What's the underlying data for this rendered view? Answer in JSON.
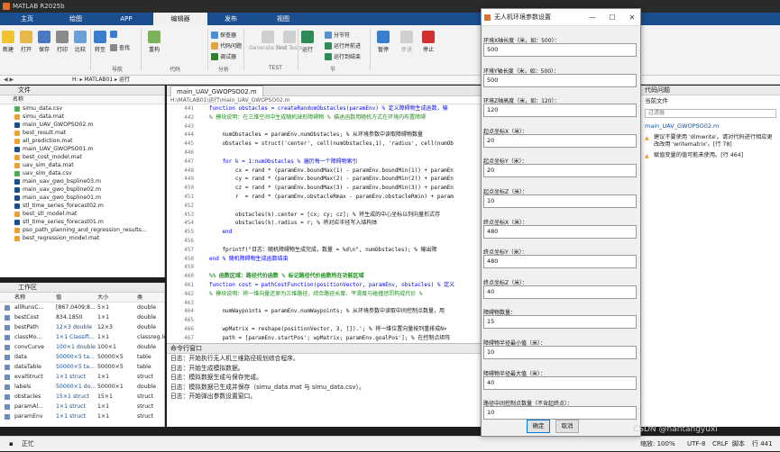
{
  "window": {
    "title": "MATLAB R2025b"
  },
  "ribbon_tabs": [
    "主页",
    "绘图",
    "APP",
    "编辑器",
    "发布",
    "视图"
  ],
  "ribbon": {
    "file": {
      "new": "新建",
      "open": "打开",
      "save": "保存",
      "print": "打印",
      "compare": "比较"
    },
    "nav": {
      "goto": "转至",
      "find": "查找",
      "group": "导航"
    },
    "code": {
      "refactor": "重构",
      "group": "代码"
    },
    "analyze": {
      "profiler": "探查器",
      "code_issues": "代码问题",
      "debugger": "调试器",
      "group": "分析"
    },
    "test": {
      "generate": "Generate Test",
      "find": "Find Tests",
      "group": "TEST"
    },
    "run": {
      "run": "运行",
      "section_break": "分节符",
      "run_advance": "运行并前进",
      "run_to_end": "运行到结束",
      "group": "节"
    },
    "debug": {
      "pause": "暂停",
      "step": "步进",
      "stop": "停止"
    }
  },
  "address": {
    "path": "H: ▸ MATLAB01 ▸ 运行"
  },
  "files_panel": {
    "title": "文件",
    "column": "名称",
    "files": [
      "simu_data.csv",
      "simu_data.mat",
      "main_UAV_GWOPSO02.m",
      "best_result.mat",
      "all_prediction.mat",
      "main_UAV_GWOPSO01.m",
      "best_cost_model.mat",
      "uav_sim_data.mat",
      "uav_sim_data.csv",
      "main_uav_gwo_bspline03.m",
      "main_uav_gwo_bspline02.m",
      "main_uav_gwo_bspline01.m",
      "stl_time_series_forecast02.m",
      "best_stl_model.mat",
      "stl_time_series_forecast01.m",
      "pso_path_planning_and_regression_results...",
      "best_regression_model.mat"
    ]
  },
  "workspace": {
    "title": "工作区",
    "columns": [
      "名称",
      "值",
      "大小",
      "类"
    ],
    "rows": [
      [
        "allRunsC...",
        "[867.0409;8...",
        "5×1",
        "double"
      ],
      [
        "bestCost",
        "834.1850",
        "1×1",
        "double"
      ],
      [
        "bestPath",
        "12×3 double",
        "12×3",
        "double"
      ],
      [
        "classMo...",
        "1×1 Classifi...",
        "1×1",
        "classreg.le"
      ],
      [
        "convCurve",
        "100×1 double",
        "100×1",
        "double"
      ],
      [
        "data",
        "50000×5 ta...",
        "50000×5",
        "table"
      ],
      [
        "dataTable",
        "50000×5 ta...",
        "50000×5",
        "table"
      ],
      [
        "evalStruct",
        "1×1 struct",
        "1×1",
        "struct"
      ],
      [
        "labels",
        "50000×1 do...",
        "50000×1",
        "double"
      ],
      [
        "obstacles",
        "15×1 struct",
        "15×1",
        "struct"
      ],
      [
        "paramAl...",
        "1×1 struct",
        "1×1",
        "struct"
      ],
      [
        "paramEnv",
        "1×1 struct",
        "1×1",
        "struct"
      ]
    ]
  },
  "editor": {
    "tab": "main_UAV_GWOPSO02.m",
    "path": "H:\\MATLAB01\\运行\\main_UAV_GWOPSO02.m",
    "lines": [
      {
        "n": "441",
        "t": "function obstacles = createRandomObstacles(paramEnv) % 定义障碍物生成函数，输"
      },
      {
        "n": "442",
        "t": "% 模块说明：在三维空间中生成随机球形障碍物 % 描述函数用随机方式在环境内布置障碍"
      },
      {
        "n": "443",
        "t": ""
      },
      {
        "n": "444",
        "t": "    numObstacles = paramEnv.numObstacles; % 从环境参数中读取障碍物数量"
      },
      {
        "n": "445",
        "t": "    obstacles = struct('center', cell(numObstacles,1), 'radius', cell(numOb"
      },
      {
        "n": "446",
        "t": ""
      },
      {
        "n": "447",
        "t": "    for k = 1:numObstacles % 遍历每一个障碍物索引"
      },
      {
        "n": "448",
        "t": "        cx = rand * (paramEnv.boundMax(1) - paramEnv.boundMin(1)) + paramEn"
      },
      {
        "n": "449",
        "t": "        cy = rand * (paramEnv.boundMax(2) - paramEnv.boundMin(2)) + paramEn"
      },
      {
        "n": "450",
        "t": "        cz = rand * (paramEnv.boundMax(3) - paramEnv.boundMin(3)) + paramEn"
      },
      {
        "n": "451",
        "t": "        r  = rand * (paramEnv.obstacleRmax - paramEnv.obstacleRmin) + param"
      },
      {
        "n": "452",
        "t": ""
      },
      {
        "n": "453",
        "t": "        obstacles(k).center = [cx; cy; cz]; % 将生成的中心坐标以列向量形式存"
      },
      {
        "n": "454",
        "t": "        obstacles(k).radius = r; % 将对应半径写入结构体"
      },
      {
        "n": "455",
        "t": "    end"
      },
      {
        "n": "456",
        "t": ""
      },
      {
        "n": "457",
        "t": "    fprintf(\"日志：随机障碍物生成完成，数量 = %d\\n\", numObstacles); % 输出障"
      },
      {
        "n": "458",
        "t": "end % 随机障碍物生成函数结束"
      },
      {
        "n": "459",
        "t": ""
      },
      {
        "n": "460",
        "t": "%% 函数区域：路径代价函数 % 标记路径代价函数所在功能区域"
      },
      {
        "n": "461",
        "t": "function cost = pathCostFunction(positionVector, paramEnv, obstacles) % 定义"
      },
      {
        "n": "462",
        "t": "% 模块说明：将一维向量还原为三维路径，综合路径长度、平滑度与碰撞惩罚构成代价 %"
      },
      {
        "n": "463",
        "t": ""
      },
      {
        "n": "464",
        "t": "    numWaypoints = paramEnv.numWaypoints; % 从环境参数中读取中间控制点数量，用"
      },
      {
        "n": "465",
        "t": ""
      },
      {
        "n": "466",
        "t": "    wpMatrix = reshape(positionVector, 3, []).'; % 将一维位置向量按列重排成N×"
      },
      {
        "n": "467",
        "t": "    path = [paramEnv.startPos'; wpMatrix; paramEnv.goalPos']; % 在控制点矩阵"
      }
    ]
  },
  "command_window": {
    "title": "命令行窗口",
    "lines": [
      "日志：开始执行无人机三维路径规划综合程序。",
      "日志：开始生成模拟数据。",
      "日志：模拟数据生成与保存完成。",
      "日志：模拟数据已生成并保存（simu_data.mat 与 simu_data.csv）。",
      "日志：开始弹出参数设置窗口。"
    ]
  },
  "code_issues": {
    "title": "代码问题",
    "current_file": "当前文件",
    "filter_placeholder": "过滤器",
    "file": "main_UAV_GWOPSO02.m",
    "issues": [
      "建议不要使用 'dlmwrite'。请对代码进行相应更改改用 'writematrix'。[行 78]",
      "赋值变量的值可能未使用。[行 464]"
    ]
  },
  "status_bar": {
    "state": "正忙",
    "zoom": "缩放: 100%",
    "encoding": "UTF-8",
    "eol": "CRLF",
    "type": "脚本",
    "position": "行 441"
  },
  "dialog": {
    "title": "无人机环境参数设置",
    "fields": [
      {
        "label": "环境X轴长度（米，如：500）：",
        "value": "500"
      },
      {
        "label": "环境Y轴长度（米，如：500）：",
        "value": "500"
      },
      {
        "label": "环境Z轴高度（米，如：120）：",
        "value": "120"
      },
      {
        "label": "起点坐标X（米）：",
        "value": "20"
      },
      {
        "label": "起点坐标Y（米）：",
        "value": "20"
      },
      {
        "label": "起点坐标Z（米）：",
        "value": "10"
      },
      {
        "label": "终点坐标X（米）：",
        "value": "480"
      },
      {
        "label": "终点坐标Y（米）：",
        "value": "480"
      },
      {
        "label": "终点坐标Z（米）：",
        "value": "40"
      },
      {
        "label": "障碍物数量：",
        "value": "15"
      },
      {
        "label": "障碍物半径最小值（米）：",
        "value": "10"
      },
      {
        "label": "障碍物半径最大值（米）：",
        "value": "40"
      },
      {
        "label": "路径中间控制点数量（不含起终点）：",
        "value": "10"
      }
    ],
    "ok": "确定",
    "cancel": "取消"
  },
  "watermark": "CSDN @nantangyuxi"
}
